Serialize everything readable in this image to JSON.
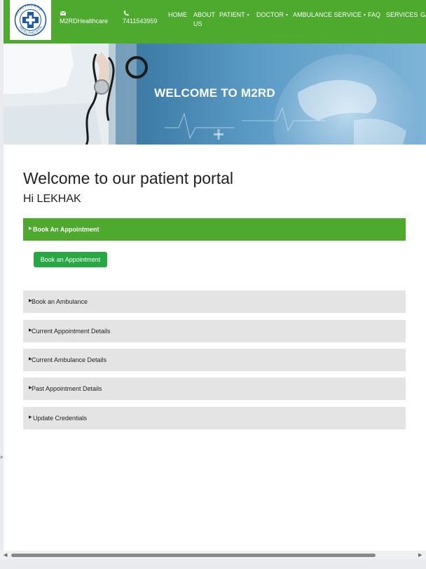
{
  "header": {
    "logo_text": "HEALTHCARE",
    "email_label": "M2RDHealthcare",
    "phone_label": "7411543959",
    "nav": [
      {
        "label": "HOME"
      },
      {
        "label": "ABOUT US"
      },
      {
        "label": "PATIENT",
        "dropdown": true
      },
      {
        "label": "DOCTOR",
        "dropdown": true
      },
      {
        "label": "AMBULANCE SERVICE",
        "dropdown": true
      },
      {
        "label": "FAQ"
      },
      {
        "label": "SERVICES"
      },
      {
        "label": "GA"
      }
    ],
    "nav_caret": "▾",
    "nav_about_line1": "ABOUT",
    "nav_about_line2": "US"
  },
  "hero": {
    "title": "WELCOME TO M2RD"
  },
  "main": {
    "title": "Welcome to our patient portal",
    "greeting": "Hi LEKHAK",
    "accordion": [
      {
        "label": "Book An Appointment",
        "active": true
      },
      {
        "label": "Book an Ambulance"
      },
      {
        "label": "Current Appointment Details"
      },
      {
        "label": "Current Ambulance Details"
      },
      {
        "label": "Past Appointment Details"
      },
      {
        "label": "Update Credentials"
      }
    ],
    "book_button": "Book an Appointment",
    "tri": "▶"
  },
  "stray_glyph": ">",
  "colors": {
    "accent": "#4eaa2e",
    "button": "#28a745",
    "panel": "#e4e4e4"
  }
}
